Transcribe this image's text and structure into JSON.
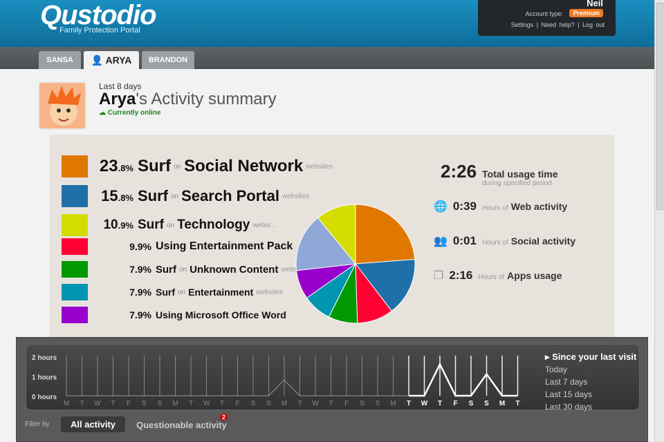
{
  "header": {
    "logo": "Qustodio",
    "logo_sub": "Family Protection Portal",
    "user": "Neil",
    "account_type_label": "Account type:",
    "account_type": "Premium",
    "links": [
      "Settings",
      "Need help?",
      "Log out"
    ]
  },
  "tabs": [
    {
      "label": "SANSA"
    },
    {
      "label": "ARYA",
      "active": true
    },
    {
      "label": "BRANDON"
    }
  ],
  "profile": {
    "period": "Last 8 days",
    "name": "Arya",
    "title_suffix": "'s Activity summary",
    "status": "Currently online"
  },
  "activities": [
    {
      "pct_main": "23",
      "pct_dec": ".8%",
      "verb": "Surf",
      "on": "on",
      "target": "Social Network",
      "suffix": "websites",
      "color": "#e07800"
    },
    {
      "pct_main": "15",
      "pct_dec": ".8%",
      "verb": "Surf",
      "on": "on",
      "target": "Search Portal",
      "suffix": "websites",
      "color": "#1f6fa8"
    },
    {
      "pct_main": "10",
      "pct_dec": ".9%",
      "verb": "Surf",
      "on": "on",
      "target": "Technology",
      "suffix": "websi...",
      "color": "#d4dc00"
    },
    {
      "pct_main": "9",
      "pct_dec": ".9%",
      "verb": "Using Entertainment Pack",
      "on": "",
      "target": "",
      "suffix": "...",
      "color": "#ff0033"
    },
    {
      "pct_main": "7",
      "pct_dec": ".9%",
      "verb": "Surf",
      "on": "on",
      "target": "Unknown Content",
      "suffix": "websites",
      "color": "#009900"
    },
    {
      "pct_main": "7",
      "pct_dec": ".9%",
      "verb": "Surf",
      "on": "on",
      "target": "Entertainment",
      "suffix": "websites",
      "color": "#0095b0"
    },
    {
      "pct_main": "7",
      "pct_dec": ".9%",
      "verb": "Using Microsoft Office Word",
      "on": "",
      "target": "",
      "suffix": "",
      "color": "#9900cc"
    }
  ],
  "chart_data": {
    "type": "pie",
    "slices": [
      {
        "label": "Surf on Social Network",
        "value": 23.8,
        "color": "#e07800"
      },
      {
        "label": "Surf on Search Portal",
        "value": 15.8,
        "color": "#1f6fa8"
      },
      {
        "label": "Using Entertainment Pack",
        "value": 9.9,
        "color": "#ff0033"
      },
      {
        "label": "Surf on Unknown Content",
        "value": 7.9,
        "color": "#009900"
      },
      {
        "label": "Surf on Entertainment",
        "value": 7.9,
        "color": "#0095b0"
      },
      {
        "label": "Using Microsoft Office Word",
        "value": 7.9,
        "color": "#9900cc"
      },
      {
        "label": "Other",
        "value": 15.9,
        "color": "#8fa8d8"
      },
      {
        "label": "Surf on Technology",
        "value": 10.9,
        "color": "#d4dc00"
      }
    ]
  },
  "totals": {
    "total": "2:26",
    "total_label": "Total usage time",
    "total_sub": "during specified period",
    "hours_of": "Hours of",
    "items": [
      {
        "value": "0:39",
        "label": "Web activity"
      },
      {
        "value": "0:01",
        "label": "Social activity"
      },
      {
        "value": "2:16",
        "label": "Apps usage"
      }
    ]
  },
  "timeline": {
    "y_labels": [
      "2 hours",
      "1 hours",
      "0 hours"
    ],
    "ymax": 2,
    "days": [
      "M",
      "T",
      "W",
      "T",
      "F",
      "S",
      "S",
      "M",
      "T",
      "W",
      "T",
      "F",
      "S",
      "S",
      "M",
      "T",
      "W",
      "T",
      "F",
      "S",
      "S",
      "M",
      "T",
      "W",
      "T",
      "F",
      "S",
      "S",
      "M",
      "T"
    ],
    "values": [
      0,
      0,
      0,
      0,
      0,
      0,
      0,
      0,
      0,
      0,
      0,
      0,
      0,
      0,
      0.8,
      0,
      0,
      0,
      0,
      0,
      0,
      0,
      0,
      0,
      1.6,
      0,
      0,
      1.1,
      0,
      0
    ],
    "highlight_from": 22
  },
  "since": {
    "title": "Since your last visit",
    "options": [
      "Today",
      "Last 7 days",
      "Last 15 days",
      "Last 30 days"
    ]
  },
  "filter": {
    "label": "Filter by",
    "all": "All activity",
    "questionable": "Questionable activity",
    "badge": "2"
  }
}
